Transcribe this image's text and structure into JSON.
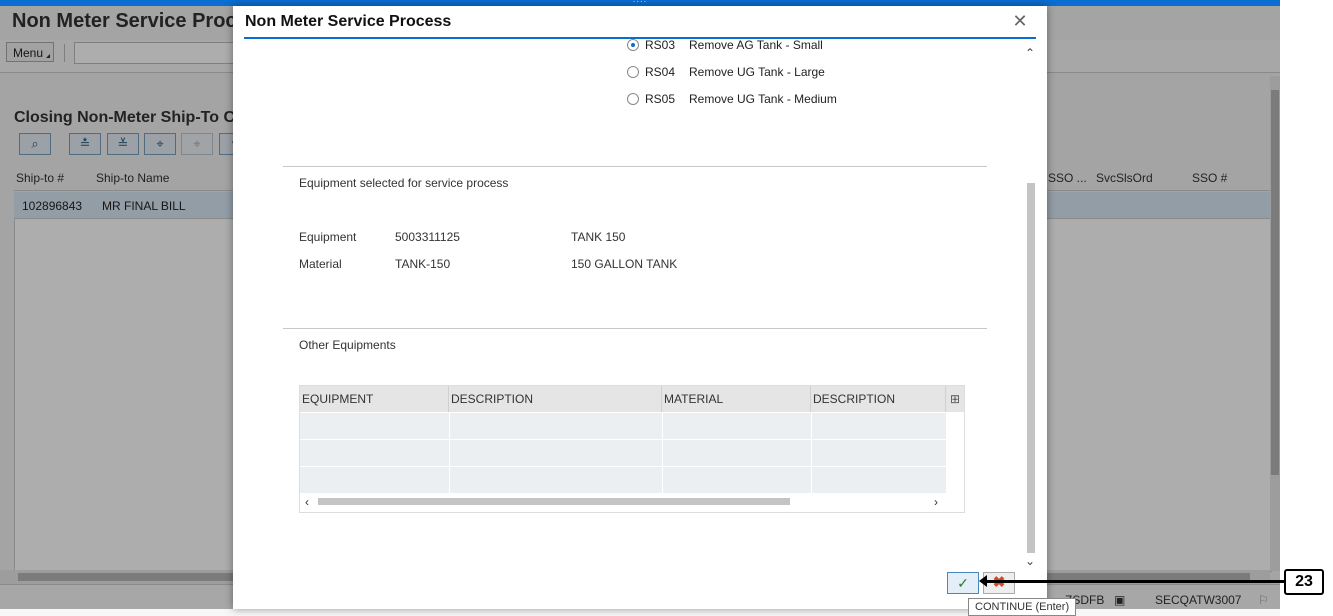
{
  "background": {
    "title": "Non Meter Service Proc",
    "menu_label": "Menu",
    "subtitle": "Closing Non-Meter Ship-To C",
    "columns_left": [
      "Ship-to #",
      "Ship-to Name"
    ],
    "columns_right": [
      "SSO ...",
      "SvcSlsOrd",
      "SSO #"
    ],
    "row": {
      "shipto": "102896843",
      "name": "MR FINAL BILL"
    },
    "status": {
      "system": "ZSDFB",
      "server": "SECQATW3007"
    }
  },
  "dialog": {
    "title": "Non Meter Service Process",
    "options": [
      {
        "code": "RS03",
        "desc": "Remove AG Tank - Small",
        "selected": true
      },
      {
        "code": "RS04",
        "desc": "Remove UG Tank - Large",
        "selected": false
      },
      {
        "code": "RS05",
        "desc": "Remove UG Tank - Medium",
        "selected": false
      }
    ],
    "selected_section": "Equipment selected for service process",
    "equipment": {
      "label": "Equipment",
      "value": "5003311125",
      "desc": "TANK 150"
    },
    "material": {
      "label": "Material",
      "value": "TANK-150",
      "desc": "150 GALLON TANK"
    },
    "other_section": "Other Equipments",
    "table_headers": [
      "EQUIPMENT",
      "DESCRIPTION",
      "MATERIAL",
      "DESCRIPTION"
    ],
    "tooltip": "CONTINUE (Enter)"
  },
  "annotation": {
    "step": "23"
  },
  "colors": {
    "accent": "#0a6ed1",
    "selected_row": "#d9e8f5"
  },
  "icons": [
    "close-icon",
    "continue-icon",
    "cancel-icon",
    "table-settings-icon"
  ]
}
